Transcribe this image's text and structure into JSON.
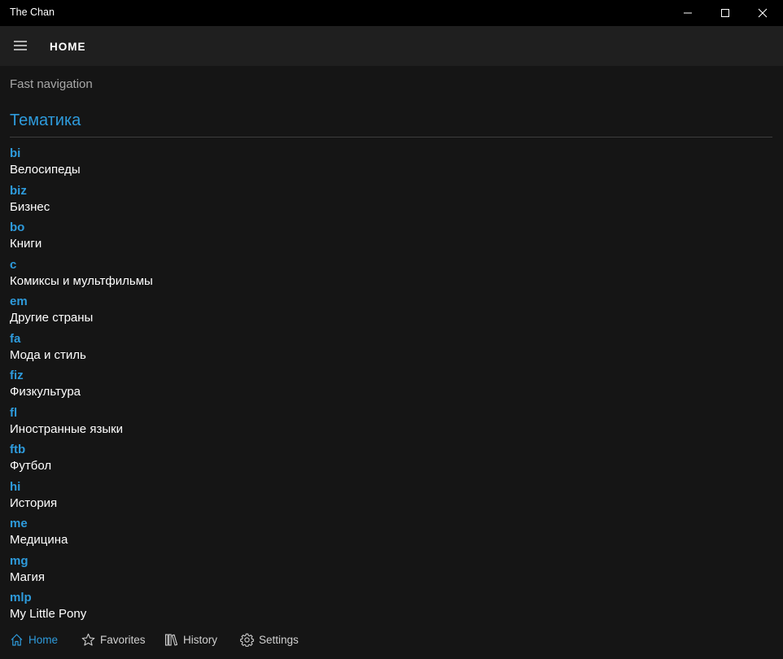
{
  "window": {
    "title": "The Chan"
  },
  "appbar": {
    "page_title": "HOME"
  },
  "content": {
    "fast_navigation_label": "Fast navigation",
    "section_title": "Тематика",
    "boards": [
      {
        "code": "bi",
        "name": "Велосипеды"
      },
      {
        "code": "biz",
        "name": "Бизнес"
      },
      {
        "code": "bo",
        "name": "Книги"
      },
      {
        "code": "c",
        "name": "Комиксы и мультфильмы"
      },
      {
        "code": "em",
        "name": "Другие страны"
      },
      {
        "code": "fa",
        "name": "Мода и стиль"
      },
      {
        "code": "fiz",
        "name": "Физкультура"
      },
      {
        "code": "fl",
        "name": "Иностранные языки"
      },
      {
        "code": "ftb",
        "name": "Футбол"
      },
      {
        "code": "hi",
        "name": "История"
      },
      {
        "code": "me",
        "name": "Медицина"
      },
      {
        "code": "mg",
        "name": "Магия"
      },
      {
        "code": "mlp",
        "name": "My Little Pony"
      }
    ]
  },
  "bottom_nav": {
    "home": "Home",
    "favorites": "Favorites",
    "history": "History",
    "settings": "Settings",
    "active": "home"
  },
  "colors": {
    "accent": "#2e9bdc",
    "background": "#151515",
    "titlebar": "#000000",
    "appbar": "#1f1f1f"
  },
  "icons": {
    "menu": "hamburger-icon",
    "minimize": "minimize-icon",
    "maximize": "maximize-icon",
    "close": "close-icon",
    "home": "home-icon",
    "favorites": "star-icon",
    "history": "library-icon",
    "settings": "gear-icon"
  }
}
